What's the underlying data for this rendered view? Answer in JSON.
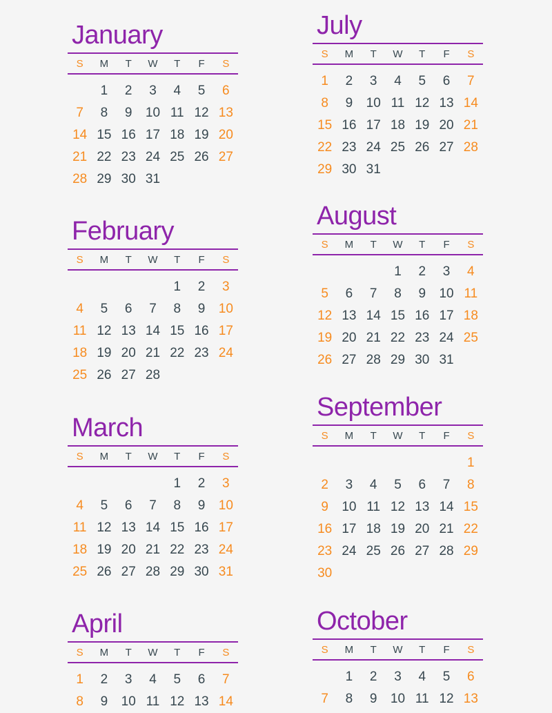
{
  "weekdays": [
    "S",
    "M",
    "T",
    "W",
    "T",
    "F",
    "S"
  ],
  "colors": {
    "month_title": "#8e24aa",
    "weekend": "#f68b1f",
    "weekday": "#37474f",
    "background": "#f5f5f5"
  },
  "months": [
    {
      "name": "January",
      "weeks": [
        [
          "",
          "1",
          "2",
          "3",
          "4",
          "5",
          "6"
        ],
        [
          "7",
          "8",
          "9",
          "10",
          "11",
          "12",
          "13"
        ],
        [
          "14",
          "15",
          "16",
          "17",
          "18",
          "19",
          "20"
        ],
        [
          "21",
          "22",
          "23",
          "24",
          "25",
          "26",
          "27"
        ],
        [
          "28",
          "29",
          "30",
          "31",
          "",
          "",
          ""
        ]
      ]
    },
    {
      "name": "February",
      "weeks": [
        [
          "",
          "",
          "",
          "",
          "1",
          "2",
          "3"
        ],
        [
          "4",
          "5",
          "6",
          "7",
          "8",
          "9",
          "10"
        ],
        [
          "11",
          "12",
          "13",
          "14",
          "15",
          "16",
          "17"
        ],
        [
          "18",
          "19",
          "20",
          "21",
          "22",
          "23",
          "24"
        ],
        [
          "25",
          "26",
          "27",
          "28",
          "",
          "",
          ""
        ]
      ]
    },
    {
      "name": "March",
      "weeks": [
        [
          "",
          "",
          "",
          "",
          "1",
          "2",
          "3"
        ],
        [
          "4",
          "5",
          "6",
          "7",
          "8",
          "9",
          "10"
        ],
        [
          "11",
          "12",
          "13",
          "14",
          "15",
          "16",
          "17"
        ],
        [
          "18",
          "19",
          "20",
          "21",
          "22",
          "23",
          "24"
        ],
        [
          "25",
          "26",
          "27",
          "28",
          "29",
          "30",
          "31"
        ]
      ]
    },
    {
      "name": "April",
      "weeks": [
        [
          "1",
          "2",
          "3",
          "4",
          "5",
          "6",
          "7"
        ],
        [
          "8",
          "9",
          "10",
          "11",
          "12",
          "13",
          "14"
        ]
      ]
    },
    {
      "name": "July",
      "weeks": [
        [
          "1",
          "2",
          "3",
          "4",
          "5",
          "6",
          "7"
        ],
        [
          "8",
          "9",
          "10",
          "11",
          "12",
          "13",
          "14"
        ],
        [
          "15",
          "16",
          "17",
          "18",
          "19",
          "20",
          "21"
        ],
        [
          "22",
          "23",
          "24",
          "25",
          "26",
          "27",
          "28"
        ],
        [
          "29",
          "30",
          "31",
          "",
          "",
          "",
          ""
        ]
      ]
    },
    {
      "name": "August",
      "weeks": [
        [
          "",
          "",
          "",
          "1",
          "2",
          "3",
          "4"
        ],
        [
          "5",
          "6",
          "7",
          "8",
          "9",
          "10",
          "11"
        ],
        [
          "12",
          "13",
          "14",
          "15",
          "16",
          "17",
          "18"
        ],
        [
          "19",
          "20",
          "21",
          "22",
          "23",
          "24",
          "25"
        ],
        [
          "26",
          "27",
          "28",
          "29",
          "30",
          "31",
          ""
        ]
      ]
    },
    {
      "name": "September",
      "weeks": [
        [
          "",
          "",
          "",
          "",
          "",
          "",
          "1"
        ],
        [
          "2",
          "3",
          "4",
          "5",
          "6",
          "7",
          "8"
        ],
        [
          "9",
          "10",
          "11",
          "12",
          "13",
          "14",
          "15"
        ],
        [
          "16",
          "17",
          "18",
          "19",
          "20",
          "21",
          "22"
        ],
        [
          "23",
          "24",
          "25",
          "26",
          "27",
          "28",
          "29"
        ],
        [
          "30",
          "",
          "",
          "",
          "",
          "",
          ""
        ]
      ]
    },
    {
      "name": "October",
      "weeks": [
        [
          "",
          "1",
          "2",
          "3",
          "4",
          "5",
          "6"
        ],
        [
          "7",
          "8",
          "9",
          "10",
          "11",
          "12",
          "13"
        ]
      ]
    }
  ]
}
